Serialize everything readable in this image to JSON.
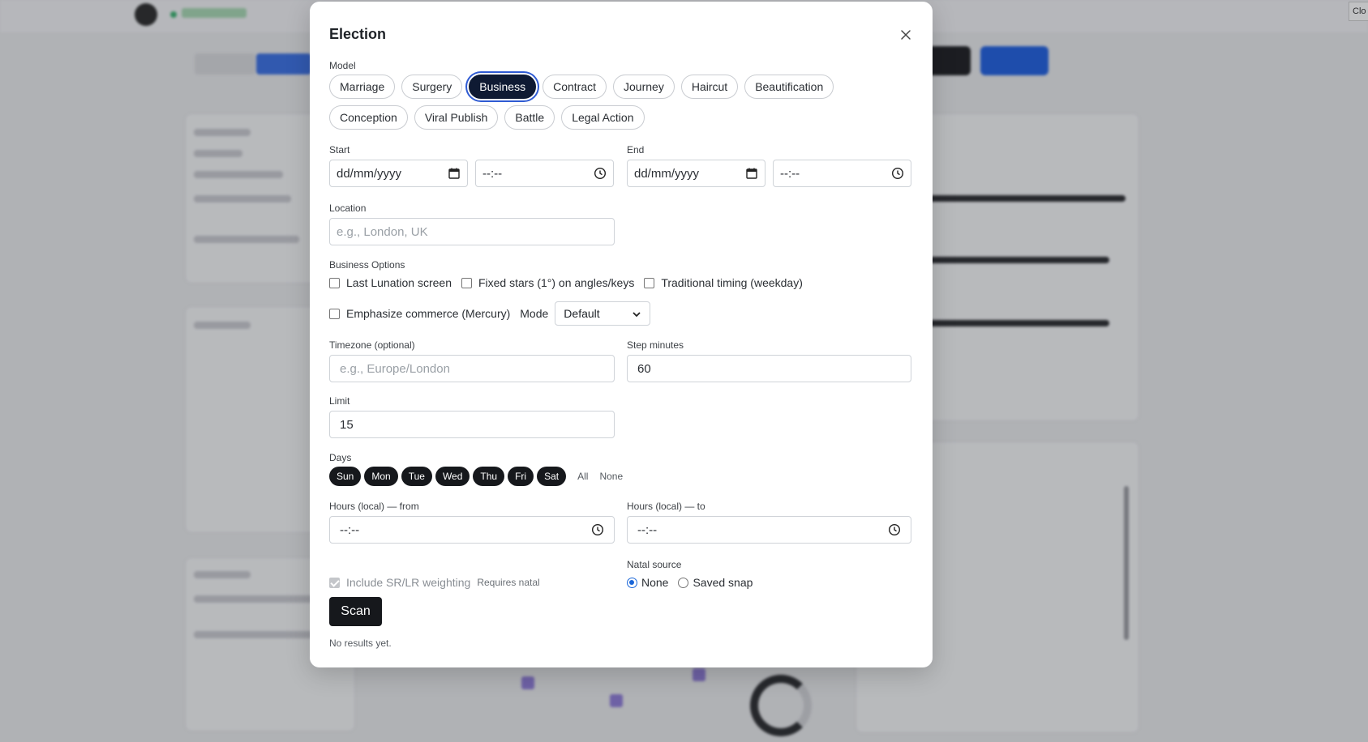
{
  "modal": {
    "title": "Election",
    "model_label": "Model",
    "models": [
      "Marriage",
      "Surgery",
      "Business",
      "Contract",
      "Journey",
      "Haircut",
      "Beautification",
      "Conception",
      "Viral Publish",
      "Battle",
      "Legal Action"
    ],
    "selected_model": "Business",
    "start_label": "Start",
    "end_label": "End",
    "date_placeholder": "dd/mm/yyyy",
    "time_placeholder": "--:--",
    "location_label": "Location",
    "location_placeholder": "e.g., London, UK",
    "options_label": "Business Options",
    "options": {
      "last_lunation": "Last Lunation screen",
      "fixed_stars": "Fixed stars (1°) on angles/keys",
      "traditional_timing": "Traditional timing (weekday)",
      "emphasize_commerce": "Emphasize commerce (Mercury)",
      "mode_label": "Mode",
      "mode_value": "Default"
    },
    "timezone_label": "Timezone (optional)",
    "timezone_placeholder": "e.g., Europe/London",
    "step_label": "Step minutes",
    "step_value": "60",
    "limit_label": "Limit",
    "limit_value": "15",
    "days_label": "Days",
    "days": [
      "Sun",
      "Mon",
      "Tue",
      "Wed",
      "Thu",
      "Fri",
      "Sat"
    ],
    "days_all": "All",
    "days_none": "None",
    "hours_from_label": "Hours (local) — from",
    "hours_to_label": "Hours (local) — to",
    "srlr_label": "Include SR/LR weighting",
    "srlr_note": "Requires natal",
    "natal_label": "Natal source",
    "natal_options": [
      "None",
      "Saved snap"
    ],
    "natal_selected": "None",
    "scan_label": "Scan",
    "results_text": "No results yet."
  },
  "background": {
    "corner_button": "Clo"
  }
}
